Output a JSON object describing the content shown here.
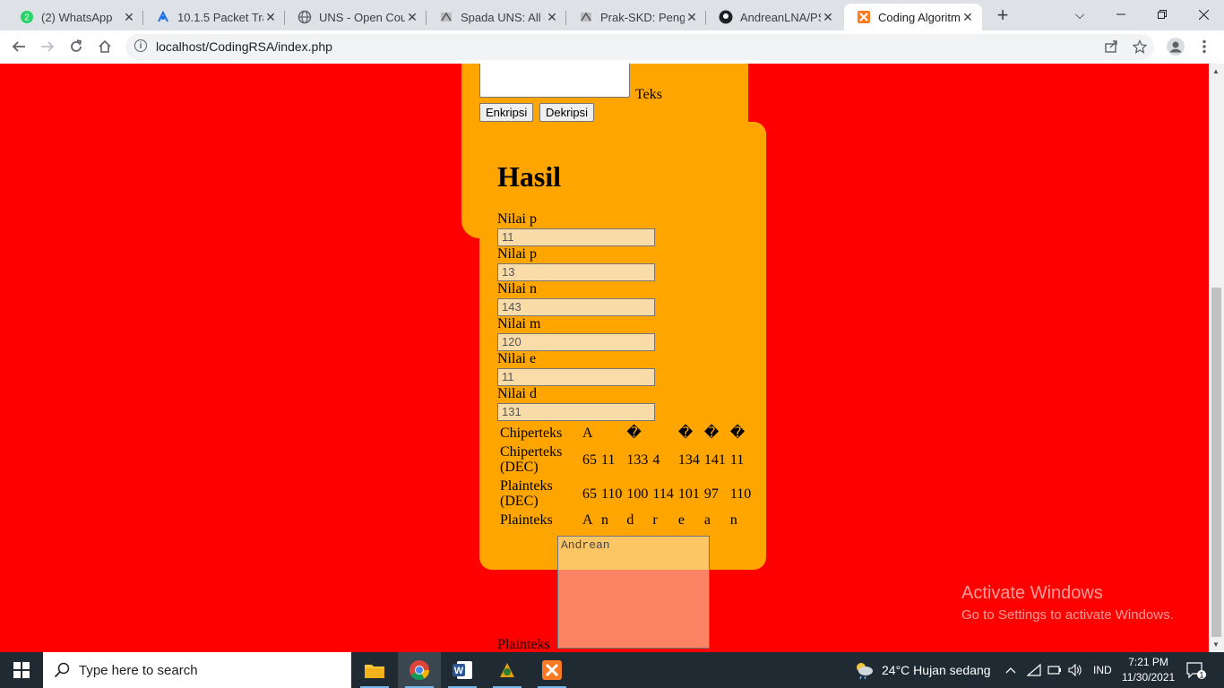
{
  "browser": {
    "tabs": [
      {
        "title": "(2) WhatsApp",
        "icon": "whatsapp-icon"
      },
      {
        "title": "10.1.5 Packet Trac",
        "icon": "packet-tracer-icon"
      },
      {
        "title": "UNS - Open Cour",
        "icon": "globe-icon"
      },
      {
        "title": "Spada UNS: All co",
        "icon": "spada-icon"
      },
      {
        "title": "Prak-SKD: Pengu",
        "icon": "spada-icon"
      },
      {
        "title": "AndreanLNA/PSK",
        "icon": "github-icon"
      },
      {
        "title": "Coding Algoritma",
        "icon": "xampp-icon",
        "active": true
      }
    ],
    "url": "localhost/CodingRSA/index.php",
    "whatsapp_badge": "2"
  },
  "form": {
    "teks_label": "Teks",
    "encrypt_label": "Enkripsi",
    "decrypt_label": "Dekripsi"
  },
  "result": {
    "title": "Hasil",
    "fields": [
      {
        "label": "Nilai p",
        "value": "11"
      },
      {
        "label": "Nilai p",
        "value": "13"
      },
      {
        "label": "Nilai n",
        "value": "143"
      },
      {
        "label": "Nilai m",
        "value": "120"
      },
      {
        "label": "Nilai e",
        "value": "11"
      },
      {
        "label": "Nilai d",
        "value": "131"
      }
    ],
    "table": {
      "chipertext_label": "Chiperteks",
      "chipertext_chars": [
        "A",
        "",
        "�",
        "",
        "�",
        "�",
        "�"
      ],
      "chipertext_dec_label": "Chiperteks (DEC)",
      "chipertext_dec": [
        "65",
        "11",
        "133",
        "4",
        "134",
        "141",
        "11"
      ],
      "plaintext_dec_label": "Plainteks (DEC)",
      "plaintext_dec": [
        "65",
        "110",
        "100",
        "114",
        "101",
        "97",
        "110"
      ],
      "plaintext_label": "Plainteks",
      "plaintext_chars": [
        "A",
        "n",
        "d",
        "r",
        "e",
        "a",
        "n"
      ]
    },
    "plaintext_area": "Andrean",
    "plaintext_area_label": "Plainteks"
  },
  "watermark": {
    "line1": "Activate Windows",
    "line2": "Go to Settings to activate Windows."
  },
  "taskbar": {
    "search_placeholder": "Type here to search",
    "weather": "24°C  Hujan sedang",
    "language": "IND",
    "time": "7:21 PM",
    "date": "11/30/2021",
    "notification_count": "1"
  }
}
